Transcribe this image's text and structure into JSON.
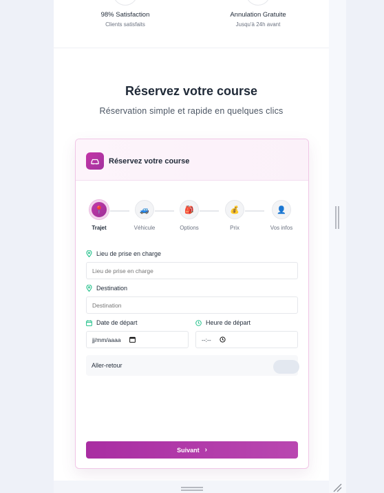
{
  "stats": [
    {
      "title": "98% Satisfaction",
      "subtitle": "Clients satisfaits"
    },
    {
      "title": "Annulation Gratuite",
      "subtitle": "Jusqu'à 24h avant"
    }
  ],
  "section": {
    "title": "Réservez votre course",
    "subtitle": "Réservation simple et rapide en quelques clics"
  },
  "card": {
    "title": "Réservez votre course",
    "header_icon": "car-icon"
  },
  "steps": [
    {
      "label": "Trajet",
      "icon": "📍",
      "active": true
    },
    {
      "label": "Véhicule",
      "icon": "🚙",
      "active": false
    },
    {
      "label": "Options",
      "icon": "🎒",
      "active": false
    },
    {
      "label": "Prix",
      "icon": "💰",
      "active": false
    },
    {
      "label": "Vos infos",
      "icon": "👤",
      "active": false
    }
  ],
  "form": {
    "pickup": {
      "label": "Lieu de prise en charge",
      "placeholder": "Lieu de prise en charge",
      "value": ""
    },
    "destination": {
      "label": "Destination",
      "placeholder": "Destination",
      "value": ""
    },
    "date": {
      "label": "Date de départ",
      "value": "jj/mm/aaaa"
    },
    "time": {
      "label": "Heure de départ",
      "value": "--:--"
    },
    "round_trip": {
      "label": "Aller-retour",
      "on": false
    }
  },
  "next_label": "Suivant",
  "colors": {
    "accent": "#b03ba8",
    "label_icon": "#22c08a"
  }
}
